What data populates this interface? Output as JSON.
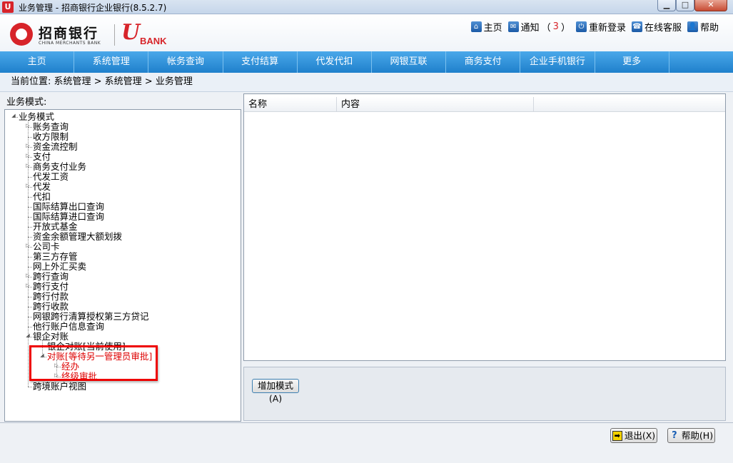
{
  "window": {
    "title": "业务管理 - 招商银行企业银行(8.5.2.7)",
    "app_icon": "U"
  },
  "brand": {
    "name_cn": "招商银行",
    "name_en": "CHINA MERCHANTS BANK",
    "ubank_u": "U",
    "ubank_text": "BANK"
  },
  "toplinks": [
    {
      "label": "主页",
      "icon": "home-icon"
    },
    {
      "label": "通知",
      "icon": "notice-icon",
      "count_prefix": "（",
      "count": "3",
      "count_suffix": "）"
    },
    {
      "label": "重新登录",
      "icon": "relogin-icon"
    },
    {
      "label": "在线客服",
      "icon": "online-service-icon"
    },
    {
      "label": "帮助",
      "icon": "help-icon"
    }
  ],
  "nav": [
    "主页",
    "系统管理",
    "帐务查询",
    "支付结算",
    "代发代扣",
    "网银互联",
    "商务支付",
    "企业手机银行",
    "更多"
  ],
  "breadcrumb": "当前位置:  系统管理 > 系统管理 > 业务管理",
  "left": {
    "label": "业务模式:",
    "tree": [
      {
        "label": "业务模式",
        "level": 0,
        "expander": "open"
      },
      {
        "label": "账务查询",
        "level": 1,
        "expander": "closed"
      },
      {
        "label": "收方限制",
        "level": 1,
        "expander": "none"
      },
      {
        "label": "资金流控制",
        "level": 1,
        "expander": "closed"
      },
      {
        "label": "支付",
        "level": 1,
        "expander": "closed"
      },
      {
        "label": "商务支付业务",
        "level": 1,
        "expander": "closed"
      },
      {
        "label": "代发工资",
        "level": 1,
        "expander": "none"
      },
      {
        "label": "代发",
        "level": 1,
        "expander": "closed"
      },
      {
        "label": "代扣",
        "level": 1,
        "expander": "none"
      },
      {
        "label": "国际结算出口查询",
        "level": 1,
        "expander": "none"
      },
      {
        "label": "国际结算进口查询",
        "level": 1,
        "expander": "none"
      },
      {
        "label": "开放式基金",
        "level": 1,
        "expander": "none"
      },
      {
        "label": "资金余额管理大额划拨",
        "level": 1,
        "expander": "none"
      },
      {
        "label": "公司卡",
        "level": 1,
        "expander": "closed"
      },
      {
        "label": "第三方存管",
        "level": 1,
        "expander": "none"
      },
      {
        "label": "网上外汇买卖",
        "level": 1,
        "expander": "none"
      },
      {
        "label": "跨行查询",
        "level": 1,
        "expander": "closed"
      },
      {
        "label": "跨行支付",
        "level": 1,
        "expander": "closed"
      },
      {
        "label": "跨行付款",
        "level": 1,
        "expander": "none"
      },
      {
        "label": "跨行收款",
        "level": 1,
        "expander": "none"
      },
      {
        "label": "网银跨行清算授权第三方贷记",
        "level": 1,
        "expander": "none"
      },
      {
        "label": "他行账户信息查询",
        "level": 1,
        "expander": "none"
      },
      {
        "label": "银企对账",
        "level": 1,
        "expander": "open"
      },
      {
        "label": "银企对账[当前使用]",
        "level": 2,
        "expander": "none"
      },
      {
        "label": "对账[等待另一管理员审批]",
        "level": 2,
        "expander": "open",
        "red": true
      },
      {
        "label": "经办",
        "level": 3,
        "expander": "closed",
        "red": true
      },
      {
        "label": "终级审批",
        "level": 3,
        "expander": "closed",
        "red": true
      },
      {
        "label": "跨境账户视图",
        "level": 1,
        "expander": "none"
      }
    ]
  },
  "grid": {
    "columns": [
      "名称",
      "内容"
    ]
  },
  "buttons": {
    "add_mode": "增加模式(A)",
    "exit": "退出(X)",
    "help": "帮助(H)"
  },
  "colors": {
    "nav_bg": "#2b8ad6",
    "highlight": "#e00000",
    "brand_red": "#d7242a"
  }
}
